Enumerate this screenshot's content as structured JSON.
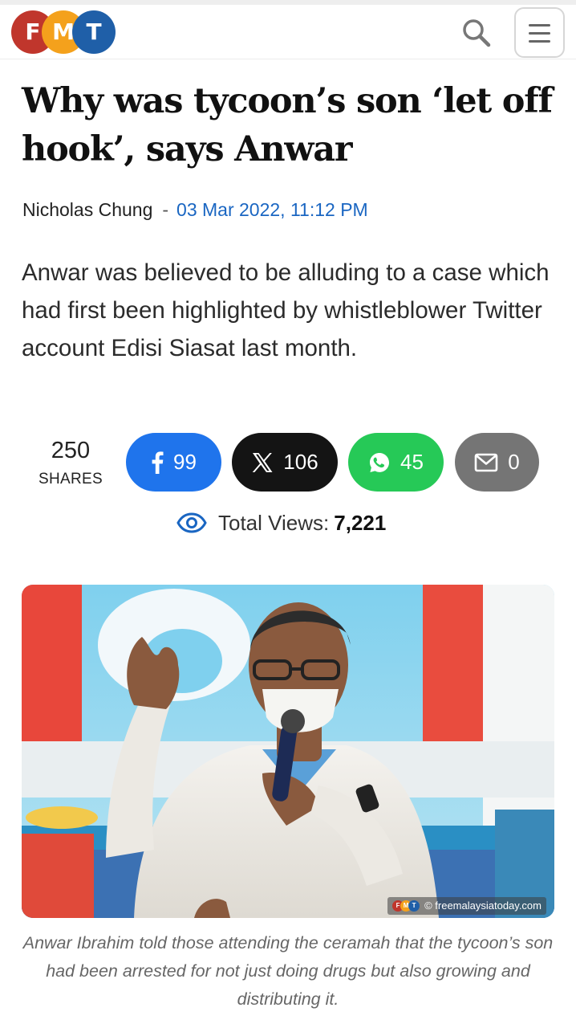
{
  "header": {
    "logo_letters": [
      "F",
      "M",
      "T"
    ],
    "logo_colors": [
      "#c0362c",
      "#f4a11c",
      "#1f5fa8"
    ],
    "search_icon": "search-icon",
    "menu_icon": "hamburger-menu-icon"
  },
  "article": {
    "headline": "Why was tycoon’s son ‘let off hook’, says Anwar",
    "author": "Nicholas Chung",
    "separator": "-",
    "date": "03 Mar 2022, 11:12 PM",
    "lede": "Anwar was believed to be alluding to a case which had first been highlighted by whistleblower Twitter account Edisi Siasat last month."
  },
  "shares": {
    "total": "250",
    "label": "SHARES",
    "buttons": [
      {
        "network": "facebook",
        "icon": "facebook-icon",
        "count": "99",
        "color": "#1f74ec"
      },
      {
        "network": "x",
        "icon": "x-icon",
        "count": "106",
        "color": "#141414"
      },
      {
        "network": "whatsapp",
        "icon": "whatsapp-icon",
        "count": "45",
        "color": "#26c957"
      },
      {
        "network": "email",
        "icon": "mail-icon",
        "count": "0",
        "color": "#757575"
      }
    ]
  },
  "views": {
    "label": "Total Views:",
    "count": "7,221",
    "icon": "eye-icon"
  },
  "image": {
    "credit": "© freemalaysiatoday.com",
    "caption": "Anwar Ibrahim told those attending the ceramah that the tycoon’s son had been arrested for not just doing drugs but also growing and distributing it."
  }
}
